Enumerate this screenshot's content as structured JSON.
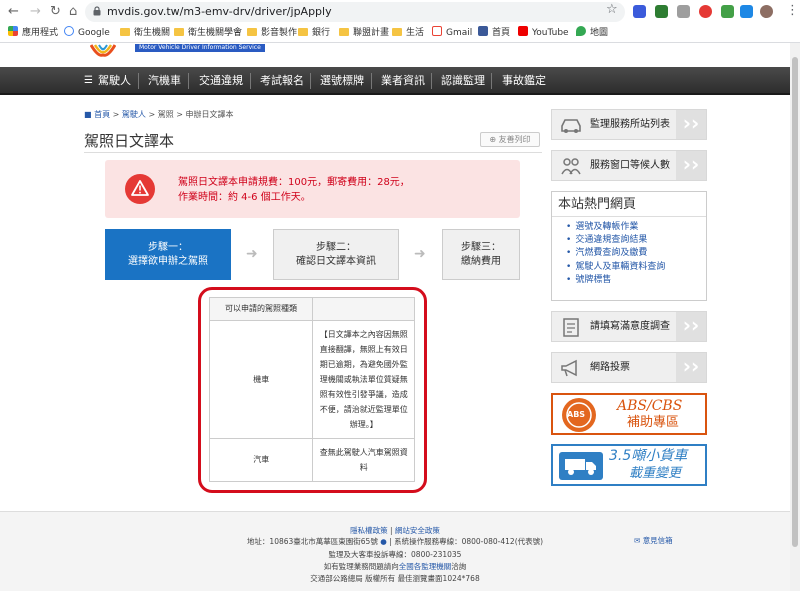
{
  "browser": {
    "url": "mvdis.gov.tw/m3-emv-drv/driver/jpApply",
    "back_icon": "arrow-left",
    "forward_icon": "arrow-right",
    "reload_icon": "reload",
    "home_icon": "home",
    "bookmarks": [
      {
        "label": "應用程式",
        "icon": "apps-grid"
      },
      {
        "label": "Google",
        "icon": "google-g"
      },
      {
        "label": "衛生機關",
        "icon": "folder"
      },
      {
        "label": "衛生機關學會",
        "icon": "folder"
      },
      {
        "label": "影音製作",
        "icon": "folder"
      },
      {
        "label": "銀行",
        "icon": "folder"
      },
      {
        "label": "聯盟計畫",
        "icon": "folder"
      },
      {
        "label": "生活",
        "icon": "folder"
      },
      {
        "label": "Gmail",
        "icon": "gmail"
      },
      {
        "label": "首頁",
        "icon": "facebook"
      },
      {
        "label": "YouTube",
        "icon": "youtube"
      },
      {
        "label": "地圖",
        "icon": "maps"
      }
    ]
  },
  "site": {
    "logo_subtitle": "Motor Vehicle Driver Information Service",
    "nav": [
      "駕駛人",
      "汽機車",
      "交通違規",
      "考試報名",
      "選號標牌",
      "業者資訊",
      "認識監理",
      "事故鑑定"
    ]
  },
  "content": {
    "breadcrumb": {
      "home": "首頁",
      "sep": ">",
      "level1": "駕駛人",
      "level2": "駕照",
      "level3": "申辦日文譯本"
    },
    "title": "駕照日文譯本",
    "print_label": "友善列印",
    "alert": {
      "line1": "駕照日文譯本申請規費：100元，郵寄費用：28元，",
      "line2": "作業時間：約 4-6 個工作天。"
    },
    "steps": [
      {
        "line1": "步驟一：",
        "line2": "選擇欲申辦之駕照"
      },
      {
        "line1": "步驟二：",
        "line2": "確認日文譯本資訊"
      },
      {
        "line1": "步驟三：",
        "line2": "繳納費用"
      }
    ],
    "table": {
      "header": "可以申請的駕照種類",
      "rows": [
        {
          "type": "機車",
          "note": "【日文譯本之內容因無照直接翻譯，無照上有效日期已逾期，為避免國外監理機關或執法單位質疑無照有效性引發爭議，造成不便，請治就近監理單位辦理。】"
        },
        {
          "type": "汽車",
          "note": "查無此駕駛人汽車駕照資料"
        }
      ]
    }
  },
  "sidebar": {
    "station_list": "監理服務所站列表",
    "wait_count": "服務窗口等候人數",
    "hot_title": "本站熱門網頁",
    "hot_links": [
      "選號及轉帳作業",
      "交通違規查詢結果",
      "汽燃費查詢及繳費",
      "駕駛人及車輛資料查詢",
      "號牌標售"
    ],
    "survey": "請填寫滿意度調查",
    "vote": "網路投票",
    "abs_title": "ABS/CBS",
    "abs_sub": "補助專區",
    "abs_badge": "ABS",
    "truck_title": "3.5噸小貨車",
    "truck_sub": "載重變更"
  },
  "footer": {
    "privacy": "隱私權政策",
    "sep": "|",
    "security": "網站安全政策",
    "address": "地址：10863臺北市萬華區東園街65號",
    "phone": "系統操作服務專線：0800-080-412(代表號)",
    "hotline": "監理及大客車投訴專線：0800-231035",
    "contact_pre": "如有監理業務問題請向",
    "contact_link": "全國各監理機關",
    "contact_post": "洽詢",
    "copyright": "交通部公路總局 版權所有",
    "resolution": "最佳瀏覽畫面1024*768",
    "mailbox": "意見信箱",
    "colors": {
      "accent_blue": "#1a73c4",
      "alert_red": "#d0021b",
      "frame_red": "#d40d1c"
    }
  }
}
